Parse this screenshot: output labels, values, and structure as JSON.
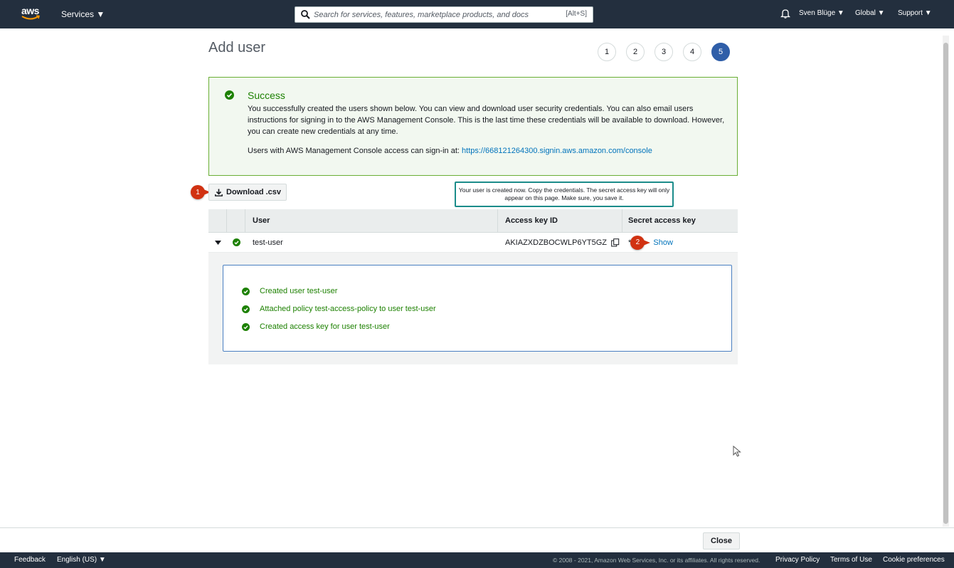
{
  "nav": {
    "logo_text": "aws",
    "services_label": "Services ▼",
    "search_placeholder": "Search for services, features, marketplace products, and docs",
    "search_shortcut": "[Alt+S]",
    "user_label": "Sven Blüge ▼",
    "region_label": "Global ▼",
    "support_label": "Support ▼"
  },
  "page": {
    "title": "Add user",
    "steps": [
      "1",
      "2",
      "3",
      "4",
      "5"
    ],
    "active_step": "5"
  },
  "success": {
    "heading": "Success",
    "message": "You successfully created the users shown below. You can view and download user security credentials. You can also email users instructions for signing in to the AWS Management Console. This is the last time these credentials will be available to download. However, you can create new credentials at any time.",
    "signin_prefix": "Users with AWS Management Console access can sign-in at: ",
    "signin_url": "https://668121264300.signin.aws.amazon.com/console"
  },
  "actions": {
    "download_label": "Download .csv",
    "close_label": "Close"
  },
  "annotations": {
    "badge1": "1",
    "badge2": "2",
    "callout": "Your user is created now. Copy the credentials. The secret access key will only appear on this page. Make sure, you save it."
  },
  "table": {
    "headers": {
      "user": "User",
      "access_key": "Access key ID",
      "secret": "Secret access key"
    },
    "row": {
      "user": "test-user",
      "access_key": "AKIAZXDZBOCWLP6YT5GZ",
      "secret_masked": "*****",
      "show_label": "Show"
    },
    "log": [
      "Created user test-user",
      "Attached policy test-access-policy to user test-user",
      "Created access key for user test-user"
    ]
  },
  "footer": {
    "feedback": "Feedback",
    "language": "English (US) ▼",
    "copyright": "© 2008 - 2021, Amazon Web Services, Inc. or its affiliates. All rights reserved.",
    "privacy": "Privacy Policy",
    "terms": "Terms of Use",
    "cookies": "Cookie preferences"
  },
  "colors": {
    "nav_bg": "#232f3e",
    "success_green": "#1d8102",
    "link_blue": "#0073bb",
    "active_step": "#2f5ea8",
    "badge_red": "#d13212",
    "callout_border": "#1b8c8a"
  },
  "icons": [
    "aws-logo",
    "chevron-down-icon",
    "search-icon",
    "bell-icon",
    "check-circle-icon",
    "download-icon",
    "copy-icon",
    "caret-down-icon",
    "cursor-icon"
  ]
}
